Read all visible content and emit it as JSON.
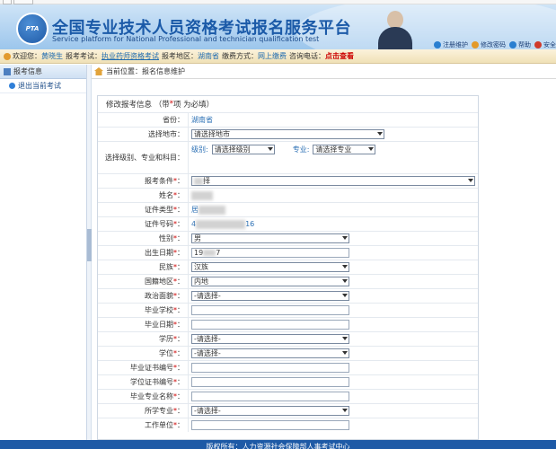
{
  "header": {
    "logo_text": "PTA",
    "title": "全国专业技术人员资格考试报名服务平台",
    "subtitle": "Service platform for National Professional and technician qualification test",
    "tools": [
      {
        "icon": "user-icon",
        "label": "注册维护",
        "color": "#2a7fd0"
      },
      {
        "icon": "key-icon",
        "label": "修改密码",
        "color": "#e39a2a"
      },
      {
        "icon": "help-icon",
        "label": "帮助",
        "color": "#2a7fd0"
      },
      {
        "icon": "exit-icon",
        "label": "安全",
        "color": "#d03a2a"
      }
    ]
  },
  "info_bar": {
    "welcome": "欢迎您：",
    "user": "黄晓生",
    "exam_label": "报考考试：",
    "exam": "执业药师资格考试",
    "region_label": "报考地区：",
    "region": "湖南省",
    "pay_label": "缴费方式：",
    "pay": "网上缴费",
    "phone_label": "咨询电话：",
    "phone_link": "点击查看"
  },
  "sidebar": {
    "header": "报考信息",
    "item": "退出当前考试"
  },
  "breadcrumb": "当前位置：报名信息维护",
  "form": {
    "title": "修改报考信息 （带",
    "title_star": "*",
    "title_tail": "项 为必填）",
    "province_label": "省份：",
    "province": "湖南省",
    "city_label": "选择地市：",
    "city": "请选择地市",
    "level_subject_label": "选择级别、专业和科目：",
    "level_label": "级别:",
    "level": "请选择级别",
    "major_label": "专业:",
    "major": "请选择专业",
    "condition_label": "报考条件",
    "condition": "择",
    "name_label": "姓名",
    "idtype_label": "证件类型",
    "idtype": "居",
    "idno_label": "证件号码",
    "idno_prefix": "4",
    "idno_suffix": "16",
    "gender_label": "性别",
    "gender": "男",
    "birth_label": "出生日期",
    "birth_prefix": "19",
    "birth_suffix": "7",
    "ethnic_label": "民族",
    "ethnic": "汉族",
    "nationality_label": "国籍地区",
    "nationality": "内地",
    "political_label": "政治面貌",
    "political": "-请选择-",
    "school_label": "毕业学校",
    "gradday_label": "毕业日期",
    "education_label": "学历",
    "education": "-请选择-",
    "degree_label": "学位",
    "degree": "-请选择-",
    "grad_cert_label": "毕业证书编号",
    "degree_cert_label": "学位证书编号",
    "grad_major_label": "毕业专业名称",
    "major_field_label": "所学专业",
    "major_field": "-请选择-",
    "workplace_label": "工作单位"
  },
  "footer": "版权所有：人力资源社会保障部人事考试中心"
}
